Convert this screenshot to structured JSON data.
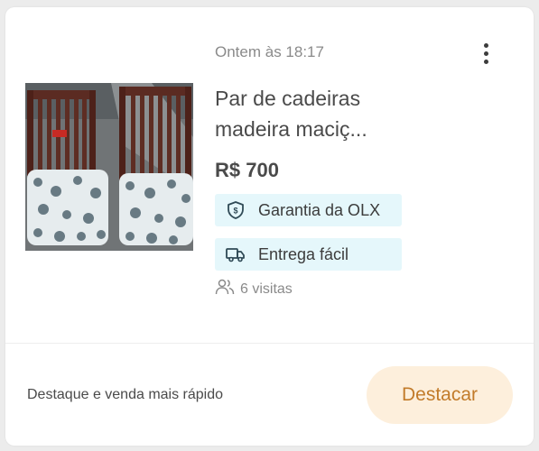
{
  "listing": {
    "date": "Ontem às 18:17",
    "title_line1": "Par de cadeiras",
    "title_line2": "madeira maciç...",
    "price": "R$ 700",
    "badges": [
      {
        "label": "Garantia da OLX",
        "icon": "shield-icon"
      },
      {
        "label": "Entrega fácil",
        "icon": "truck-icon"
      }
    ],
    "visits": "6 visitas",
    "visits_icon": "people-icon",
    "menu_icon": "kebab-menu-icon",
    "image_alt": "Par de cadeiras de madeira com assento estampado"
  },
  "footer": {
    "promo_text": "Destaque e venda mais rápido",
    "cta_label": "Destacar"
  },
  "colors": {
    "badge_bg": "#e5f7fb",
    "cta_bg": "#fdefdc",
    "cta_text": "#c27b2a"
  }
}
